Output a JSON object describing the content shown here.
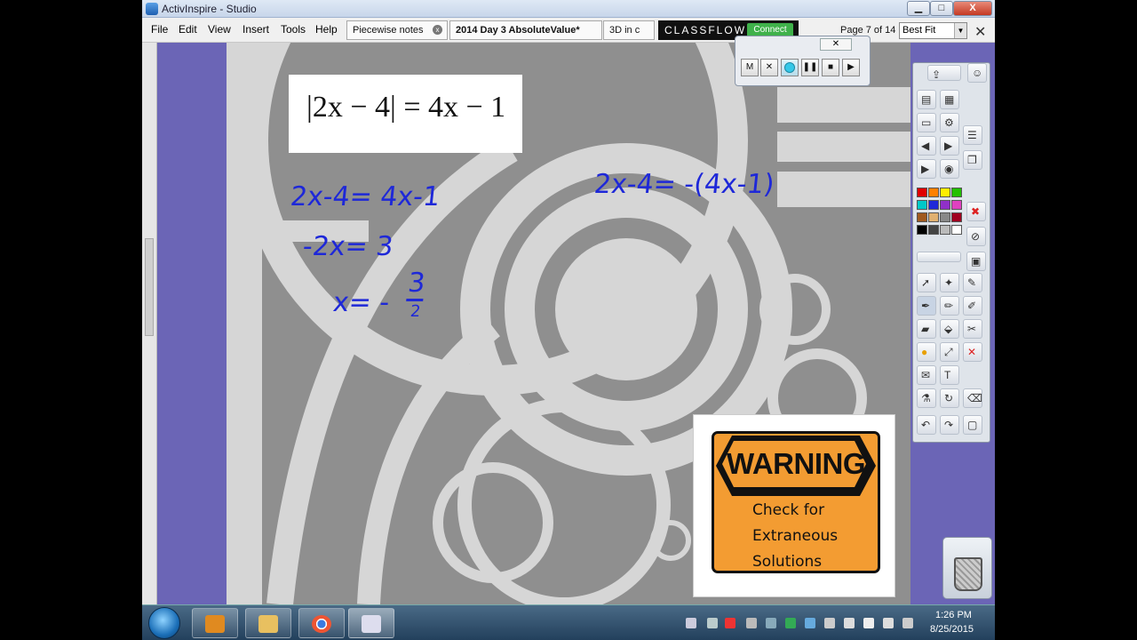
{
  "window": {
    "title": "ActivInspire - Studio",
    "minimize": "▁",
    "maximize": "□",
    "close": "X"
  },
  "menu": [
    "File",
    "Edit",
    "View",
    "Insert",
    "Tools",
    "Help"
  ],
  "tabs": [
    {
      "label": "Piecewise notes",
      "active": false
    },
    {
      "label": "2014 Day 3 AbsoluteValue*",
      "active": true
    },
    {
      "label": "3D in c",
      "active": false
    }
  ],
  "classflow": {
    "label": "CLASSFLOW",
    "connect": "Connect"
  },
  "page_indicator": "Page 7 of 14",
  "zoom": {
    "value": "Best Fit"
  },
  "flipchart": {
    "equation": {
      "abs_open": "|",
      "inner": "2x − 4",
      "abs_close": "|",
      "rest": "= 4x − 1"
    },
    "handwriting": {
      "line1": "2x-4= 4x-1",
      "line2": "-2x= 3",
      "line3_lhs": "x= -",
      "line3_num": "3",
      "line3_den": "2",
      "right": "2x-4= -(4x-1)"
    },
    "warning": {
      "title": "WARNING",
      "lines": [
        "Check for",
        "Extraneous",
        "Solutions"
      ]
    }
  },
  "recorder": {
    "close": "✕",
    "buttons": [
      "M",
      "✕",
      "",
      "❚❚",
      "■",
      "▶"
    ]
  },
  "taskbar": {
    "time": "1:26 PM",
    "date": "8/25/2015"
  },
  "colors": {
    "ink": "#1e28d8",
    "warning_orange": "#f39c32",
    "sidebar_purple": "#6b65b6"
  }
}
